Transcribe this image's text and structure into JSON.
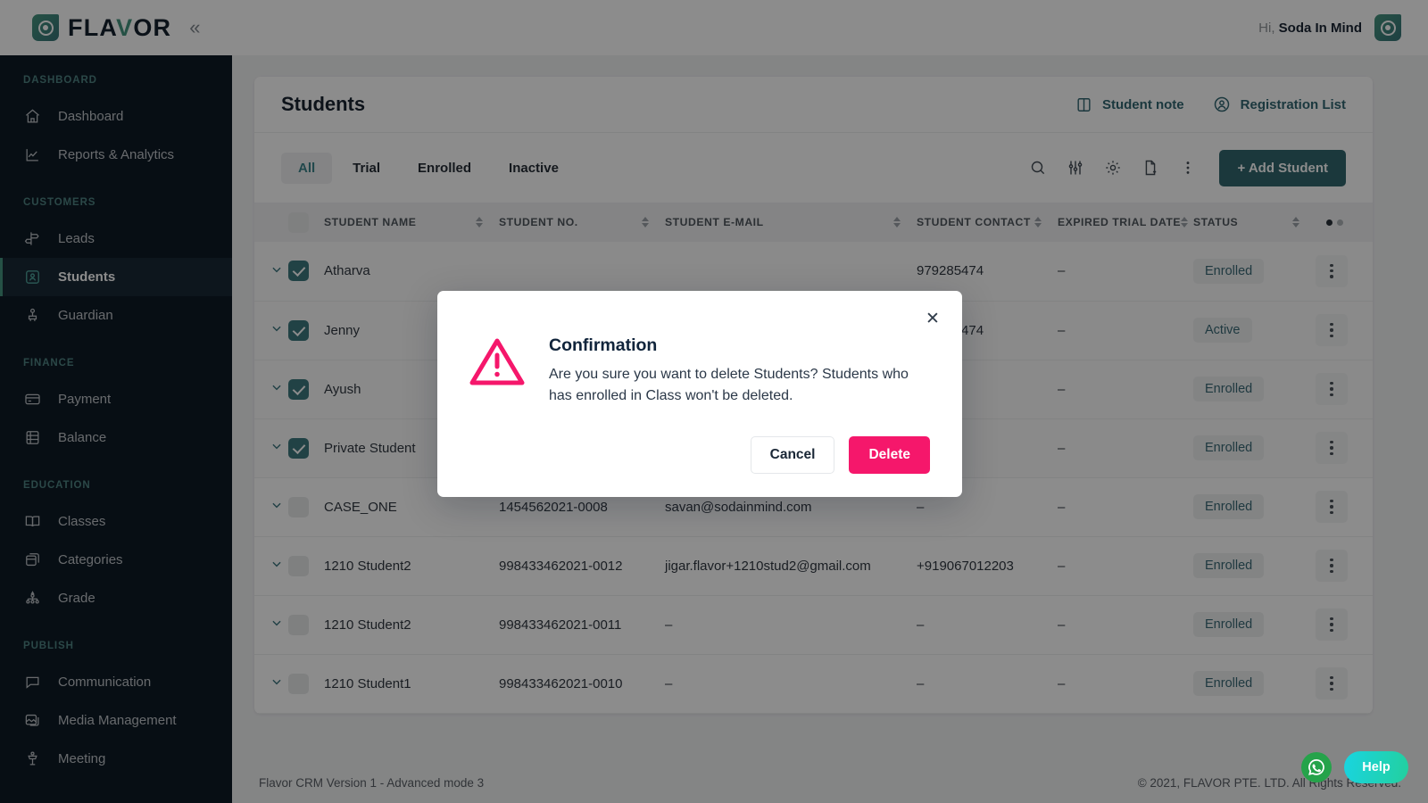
{
  "brand": {
    "name_plain": "FLA",
    "name_accent": "V",
    "name_rest": "OR",
    "collapse_glyph": "«"
  },
  "topbar": {
    "greeting_prefix": "Hi,",
    "user_name": "Soda In Mind"
  },
  "sidebar": {
    "groups": [
      {
        "label": "DASHBOARD",
        "items": [
          {
            "label": "Dashboard",
            "icon": "home-icon",
            "active": false
          },
          {
            "label": "Reports & Analytics",
            "icon": "chart-line-icon",
            "active": false
          }
        ]
      },
      {
        "label": "CUSTOMERS",
        "items": [
          {
            "label": "Leads",
            "icon": "signpost-icon",
            "active": false
          },
          {
            "label": "Students",
            "icon": "student-card-icon",
            "active": true
          },
          {
            "label": "Guardian",
            "icon": "guardian-icon",
            "active": false
          }
        ]
      },
      {
        "label": "FINANCE",
        "items": [
          {
            "label": "Payment",
            "icon": "credit-card-icon",
            "active": false
          },
          {
            "label": "Balance",
            "icon": "ledger-icon",
            "active": false
          }
        ]
      },
      {
        "label": "EDUCATION",
        "items": [
          {
            "label": "Classes",
            "icon": "book-open-icon",
            "active": false
          },
          {
            "label": "Categories",
            "icon": "boxes-icon",
            "active": false
          },
          {
            "label": "Grade",
            "icon": "hierarchy-icon",
            "active": false
          }
        ]
      },
      {
        "label": "PUBLISH",
        "items": [
          {
            "label": "Communication",
            "icon": "chat-bubble-icon",
            "active": false
          },
          {
            "label": "Media Management",
            "icon": "image-icon",
            "active": false
          },
          {
            "label": "Meeting",
            "icon": "podium-icon",
            "active": false
          }
        ]
      }
    ]
  },
  "page": {
    "title": "Students",
    "head_actions": [
      {
        "label": "Student note",
        "icon": "note-book-icon"
      },
      {
        "label": "Registration List",
        "icon": "user-circle-icon"
      }
    ]
  },
  "toolbar": {
    "tabs": [
      {
        "label": "All",
        "active": true
      },
      {
        "label": "Trial",
        "active": false
      },
      {
        "label": "Enrolled",
        "active": false
      },
      {
        "label": "Inactive",
        "active": false
      }
    ],
    "icons": [
      "search-icon",
      "filter-sliders-icon",
      "gear-icon",
      "file-add-icon",
      "kebab-menu-icon"
    ],
    "add_button": "+ Add Student"
  },
  "table": {
    "columns": [
      {
        "key": "name",
        "label": "STUDENT NAME",
        "sortable": true
      },
      {
        "key": "no",
        "label": "STUDENT NO.",
        "sortable": true
      },
      {
        "key": "mail",
        "label": "STUDENT E-MAIL",
        "sortable": true
      },
      {
        "key": "con",
        "label": "STUDENT CONTACT",
        "sortable": true
      },
      {
        "key": "trial",
        "label": "EXPIRED TRIAL DATE",
        "sortable": true
      },
      {
        "key": "stat",
        "label": "STATUS",
        "sortable": true
      }
    ],
    "rows": [
      {
        "name": "Atharva",
        "no": "",
        "mail": "",
        "con": "979285474",
        "trial": "–",
        "status": "Enrolled",
        "checked": true
      },
      {
        "name": "Jenny",
        "no": "",
        "mail": "",
        "con": "979285474",
        "trial": "–",
        "status": "Active",
        "checked": true
      },
      {
        "name": "Ayush",
        "no": "",
        "mail": "",
        "con": "",
        "trial": "–",
        "status": "Enrolled",
        "checked": true
      },
      {
        "name": "Private Student",
        "no": "",
        "mail": "",
        "con": "",
        "trial": "–",
        "status": "Enrolled",
        "checked": true
      },
      {
        "name": "CASE_ONE",
        "no": "1454562021-0008",
        "mail": "savan@sodainmind.com",
        "con": "–",
        "trial": "–",
        "status": "Enrolled",
        "checked": false
      },
      {
        "name": "1210 Student2",
        "no": "998433462021-0012",
        "mail": "jigar.flavor+1210stud2@gmail.com",
        "con": "+919067012203",
        "trial": "–",
        "status": "Enrolled",
        "checked": false
      },
      {
        "name": "1210 Student2",
        "no": "998433462021-0011",
        "mail": "–",
        "con": "–",
        "trial": "–",
        "status": "Enrolled",
        "checked": false
      },
      {
        "name": "1210 Student1",
        "no": "998433462021-0010",
        "mail": "–",
        "con": "–",
        "trial": "–",
        "status": "Enrolled",
        "checked": false
      }
    ]
  },
  "modal": {
    "title": "Confirmation",
    "message": "Are you sure you want to delete Students? Students who has enrolled in Class won't be deleted.",
    "cancel_label": "Cancel",
    "delete_label": "Delete",
    "close_glyph": "✕",
    "icon": "warning-triangle-icon"
  },
  "footer": {
    "version": "Flavor CRM Version 1 - Advanced mode 3",
    "copyright": "© 2021, FLAVOR PTE. LTD. All Rights Reserved."
  },
  "widgets": {
    "whatsapp": "whatsapp-icon",
    "help_label": "Help"
  },
  "colors": {
    "accent_teal": "#0E6E7C",
    "sidebar_bg": "#041C2F",
    "danger_pink": "#F5176B",
    "brand_green": "#12A37A",
    "status_text": "#1A6F87"
  }
}
